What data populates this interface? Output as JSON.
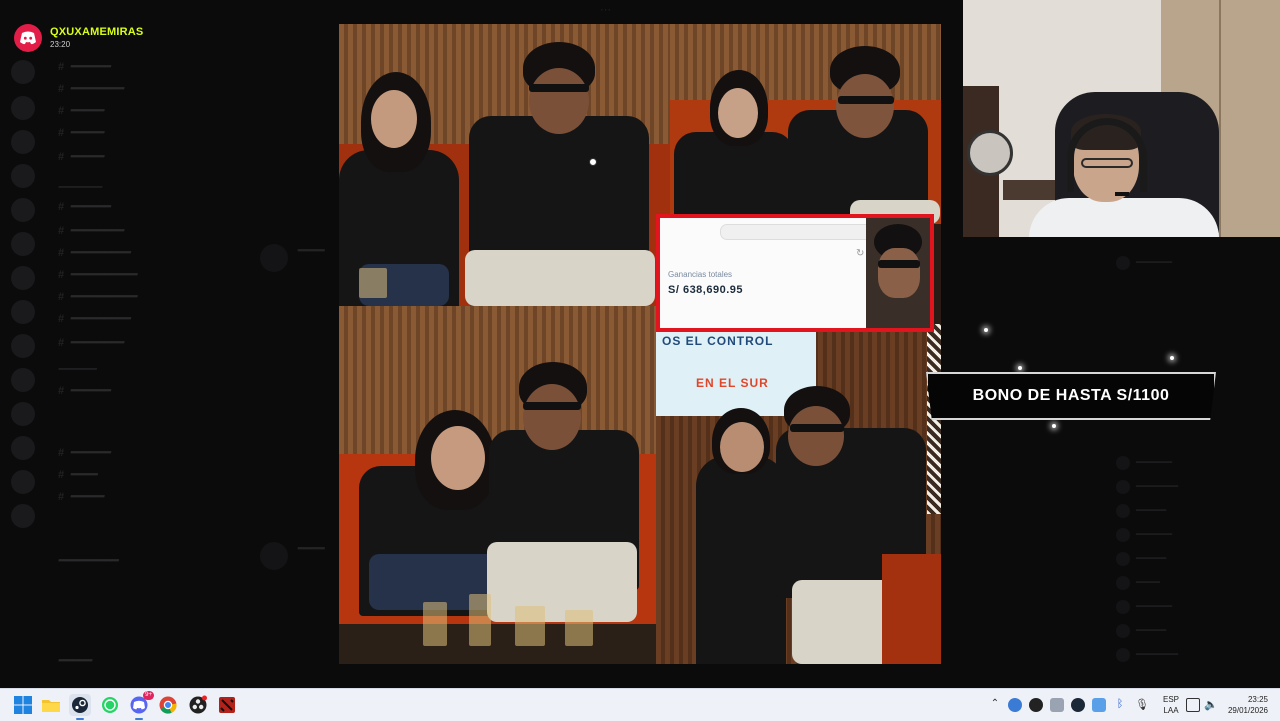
{
  "notification": {
    "app": "Discord",
    "username": "QXUXAMEMIRAS",
    "time": "23:20"
  },
  "stream": {
    "bono_banner": "BONO DE HASTA S/1100"
  },
  "earnings_card": {
    "label": "Ganancias totales",
    "amount": "S/ 638,690.95"
  },
  "taskbar": {
    "apps": [
      "start-icon",
      "file-explorer-icon",
      "steam-icon",
      "whatsapp-icon",
      "discord-icon",
      "chrome-icon",
      "obs-icon",
      "dota2-icon"
    ],
    "discord_badge": "9+",
    "lang_top": "ESP",
    "lang_bottom": "LAA",
    "time": "23:25",
    "date": "29/01/2026"
  },
  "colors": {
    "notif_name": "#d8ff1a",
    "discord_logo": "#e11d48",
    "card_border": "#e2141e"
  }
}
